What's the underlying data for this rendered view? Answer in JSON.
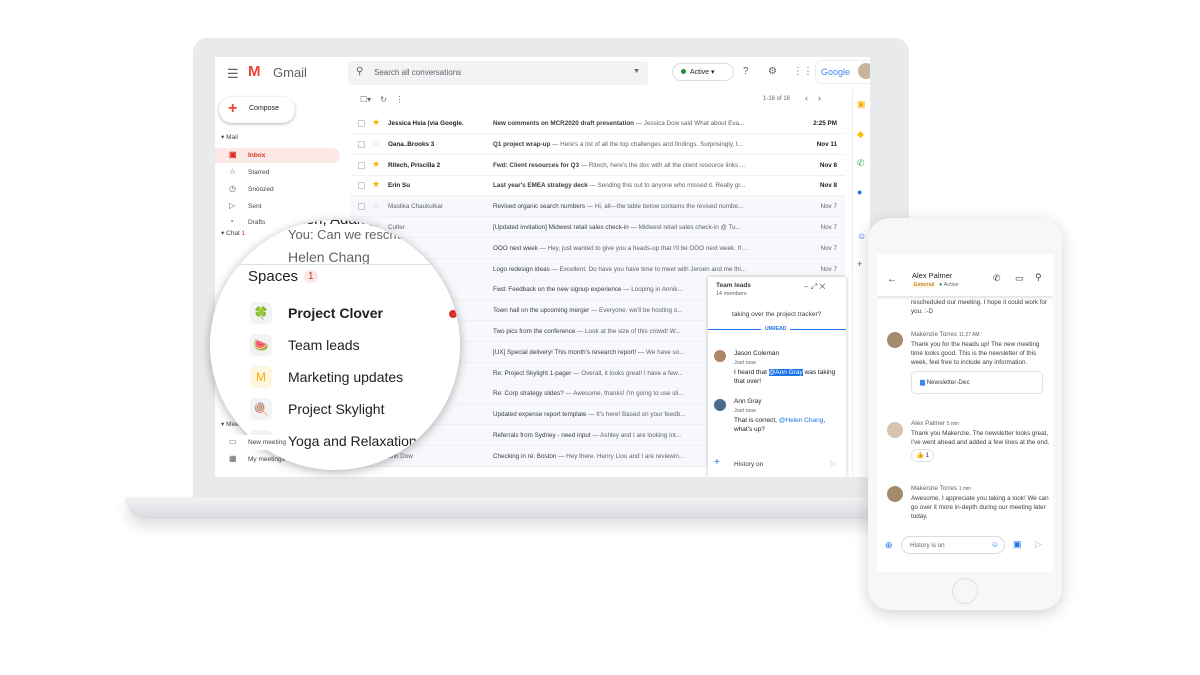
{
  "app": {
    "name": "Gmail",
    "search_placeholder": "Search all conversations",
    "status": "Active",
    "brand": "Google",
    "compose": "Compose"
  },
  "colors": {
    "accent": "#d93025",
    "star": "#f4b400",
    "link": "#1a73e8",
    "active": "#1e8e3e"
  },
  "sidebar": {
    "mail_header": "Mail",
    "items": [
      "Inbox",
      "Starred",
      "Snoozed",
      "Sent",
      "Drafts"
    ],
    "chat_header": "Chat",
    "chat_badge": "1",
    "meet_header": "Meet",
    "meet_items": [
      "New meeting",
      "My meetings"
    ]
  },
  "list": {
    "pagination": "1-16 of 16",
    "rows": [
      {
        "sender": "Jessica Hsia (via Google.",
        "subject": "New comments on MCR2020 draft presentation",
        "snippet": " — Jessica Dow said What about Eva...",
        "date": "2:25 PM",
        "starred": true,
        "unread": true
      },
      {
        "sender": "Oana..Brooks 3",
        "subject": "Q1 project wrap-up",
        "snippet": " — Here's a list of all the top challenges and findings. Surprisingly, t...",
        "date": "Nov 11",
        "starred": false,
        "unread": true
      },
      {
        "sender": "Ritech, Priscilla 2",
        "subject": "Fwd: Client resources for Q3",
        "snippet": " — Ritech, here's the doc with all the client resource links ...",
        "date": "Nov 8",
        "starred": true,
        "unread": true
      },
      {
        "sender": "Erin Su",
        "subject": "Last year's EMEA strategy deck",
        "snippet": " — Sending this out to anyone who missed it. Really gr...",
        "date": "Nov 8",
        "starred": true,
        "unread": true
      },
      {
        "sender": "Maslika Chaukulkar",
        "subject": "Revised organic search numbers",
        "snippet": " — Hi, all—the table below contains the revised numbe...",
        "date": "Nov 7",
        "starred": false,
        "unread": false
      },
      {
        "sender": "Cutler",
        "subject": "[Updated invitation] Midwest retail sales check-in",
        "snippet": " — Midwest retail sales check-in @ Tu...",
        "date": "Nov 7",
        "starred": false,
        "unread": false
      },
      {
        "sender": "",
        "subject": "OOO next week",
        "snippet": " — Hey, just wanted to give you a heads-up that I'll be OOO next week. If ...",
        "date": "Nov 7",
        "starred": false,
        "unread": false
      },
      {
        "sender": "",
        "subject": "Logo redesign ideas",
        "snippet": " — Excellent. Do have you have time to meet with Jeroen and me thi...",
        "date": "Nov 7",
        "starred": false,
        "unread": false
      },
      {
        "sender": "",
        "subject": "Fwd: Feedback on the new signup experience",
        "snippet": " — Looping in Annik...",
        "date": "",
        "starred": false,
        "unread": false
      },
      {
        "sender": "",
        "subject": "Town hall on the upcoming merger",
        "snippet": " — Everyone, we'll be hosting o...",
        "date": "",
        "starred": false,
        "unread": false
      },
      {
        "sender": "",
        "subject": "Two pics from the conference",
        "snippet": " — Look at the size of this crowd! W...",
        "date": "",
        "starred": false,
        "unread": false
      },
      {
        "sender": "",
        "subject": "[UX] Special delivery! This month's research report!",
        "snippet": " — We have so...",
        "date": "",
        "starred": false,
        "unread": false
      },
      {
        "sender": "",
        "subject": "Re: Project Skylight 1-pager",
        "snippet": " — Overall, it looks great! I have a few...",
        "date": "",
        "starred": false,
        "unread": false
      },
      {
        "sender": "",
        "subject": "Re: Corp strategy slides?",
        "snippet": " — Awesome, thanks! I'm going to use sli...",
        "date": "",
        "starred": false,
        "unread": false
      },
      {
        "sender": "",
        "subject": "Updated expense report template",
        "snippet": " — It's here! Based on your feedb...",
        "date": "",
        "starred": false,
        "unread": false
      },
      {
        "sender": "",
        "subject": "Referrals from Sydney - need input",
        "snippet": " — Ashley and I are looking int...",
        "date": "",
        "starred": false,
        "unread": false
      },
      {
        "sender": "ann Dow",
        "subject": "Checking in re: Boston",
        "snippet": " — Hey there. Henry Liou and I are reviewin...",
        "date": "",
        "starred": false,
        "unread": false
      }
    ]
  },
  "chat_window": {
    "title": "Team leads",
    "members": "14 members",
    "prev": "taking over the project tracker?",
    "divider": "UNREAD",
    "messages": [
      {
        "name": "Jason Coleman",
        "time": "Just now",
        "pre": "I heard that ",
        "mention": "@Ann Gray",
        "post": " was taking that over!"
      },
      {
        "name": "Ann Gray",
        "time": "Just now",
        "pre": "That is correct, ",
        "mention": "@Helen Chang",
        "post": ", what's up?"
      }
    ],
    "input": "History on"
  },
  "magnifier": {
    "dm_names": "...len, Adam, Greg",
    "dm_preview": "You: Can we reschedule t...",
    "dm2": "Helen Chang",
    "spaces_title": "Spaces",
    "spaces_badge": "1",
    "spaces": [
      {
        "name": "Project Clover",
        "icon": "🍀",
        "unread": true
      },
      {
        "name": "Team leads",
        "icon": "🍉",
        "unread": false
      },
      {
        "name": "Marketing updates",
        "icon": "M",
        "unread": false
      },
      {
        "name": "Project Skylight",
        "icon": "🍭",
        "unread": false
      },
      {
        "name": "Yoga and Relaxation",
        "icon": "",
        "unread": false
      }
    ]
  },
  "phone": {
    "contact": "Alex Palmer",
    "tag": "External",
    "status": "Active",
    "prev": "rescheduled our meeting. I hope it could work for you. :-D",
    "messages": [
      {
        "name": "Makenzie Torres",
        "time": "11:27 AM",
        "text": "Thank you for the heads up! The new meeting time looks good. This is the newsletter of this week, feel free to include any information.",
        "attachment": "Newsletter-Dec"
      },
      {
        "name": "Alex Palmer",
        "time": "5 min",
        "text": "Thank you Makenzie. The newsletter looks great, I've went ahead and added a few lines at the end.",
        "reaction": "👍 1"
      },
      {
        "name": "Makenzie Torres",
        "time": "1 min",
        "text": "Awesome, I appreciate you taking a look! We can go over it more in-depth during our meeting later today."
      }
    ],
    "input": "History is on"
  }
}
